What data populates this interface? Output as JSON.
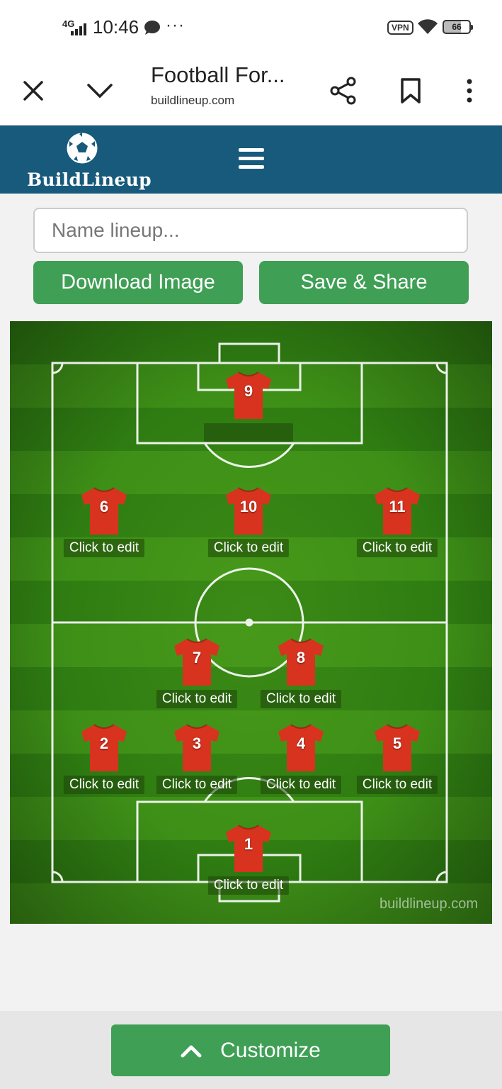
{
  "status_bar": {
    "network": "4G",
    "time": "10:46",
    "dots": "···",
    "vpn": "VPN",
    "battery": "66"
  },
  "browser": {
    "title": "Football For...",
    "url": "buildlineup.com"
  },
  "site": {
    "logo_text": "BuildLineup"
  },
  "form": {
    "name_placeholder": "Name lineup...",
    "download_label": "Download Image",
    "save_label": "Save & Share"
  },
  "pitch": {
    "watermark": "buildlineup.com",
    "shirt_color": "#d8331f",
    "players": [
      {
        "number": "9",
        "label": ""
      },
      {
        "number": "6",
        "label": "Click to edit"
      },
      {
        "number": "10",
        "label": "Click to edit"
      },
      {
        "number": "11",
        "label": "Click to edit"
      },
      {
        "number": "7",
        "label": "Click to edit"
      },
      {
        "number": "8",
        "label": "Click to edit"
      },
      {
        "number": "2",
        "label": "Click to edit"
      },
      {
        "number": "3",
        "label": "Click to edit"
      },
      {
        "number": "4",
        "label": "Click to edit"
      },
      {
        "number": "5",
        "label": "Click to edit"
      },
      {
        "number": "1",
        "label": "Click to edit"
      }
    ]
  },
  "bottom": {
    "customize_label": "Customize"
  },
  "colors": {
    "header_bg": "#175a7b",
    "button_green": "#3f9f55"
  }
}
